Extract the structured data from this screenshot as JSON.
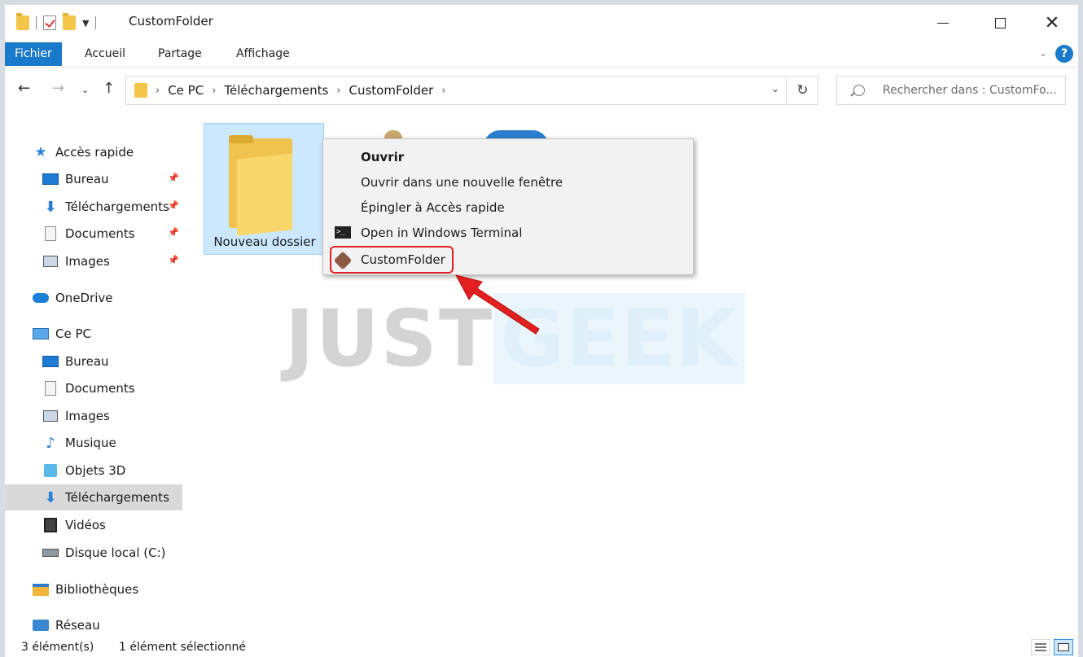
{
  "window": {
    "title": "CustomFolder"
  },
  "ribbon": {
    "tabs": [
      {
        "label": "Fichier"
      },
      {
        "label": "Accueil"
      },
      {
        "label": "Partage"
      },
      {
        "label": "Affichage"
      }
    ]
  },
  "address": {
    "crumbs": [
      "Ce PC",
      "Téléchargements",
      "CustomFolder"
    ]
  },
  "search": {
    "placeholder": "Rechercher dans : CustomFo..."
  },
  "sidebar": {
    "quick_access": "Accès rapide",
    "quick_items": [
      "Bureau",
      "Téléchargements",
      "Documents",
      "Images"
    ],
    "onedrive": "OneDrive",
    "this_pc": "Ce PC",
    "pc_items": [
      "Bureau",
      "Documents",
      "Images",
      "Musique",
      "Objets 3D",
      "Téléchargements",
      "Vidéos",
      "Disque local (C:)"
    ],
    "libraries": "Bibliothèques",
    "network": "Réseau"
  },
  "content": {
    "folder_name": "Nouveau dossier"
  },
  "context_menu": {
    "items": [
      {
        "label": "Ouvrir",
        "icon": ""
      },
      {
        "label": "Ouvrir dans une nouvelle fenêtre",
        "icon": ""
      },
      {
        "label": "Épingler à Accès rapide",
        "icon": ""
      },
      {
        "label": "Open in Windows Terminal",
        "icon": "terminal-icon"
      },
      {
        "label": "CustomFolder",
        "icon": "customfolder-icon"
      }
    ],
    "highlight_color": "#e02020"
  },
  "watermark": {
    "part1": "JUST",
    "part2": "GEEK"
  },
  "status": {
    "count": "3 élément(s)",
    "selected": "1 élément sélectionné"
  },
  "colors": {
    "accent": "#1979ca",
    "selection": "#cce8ff"
  }
}
